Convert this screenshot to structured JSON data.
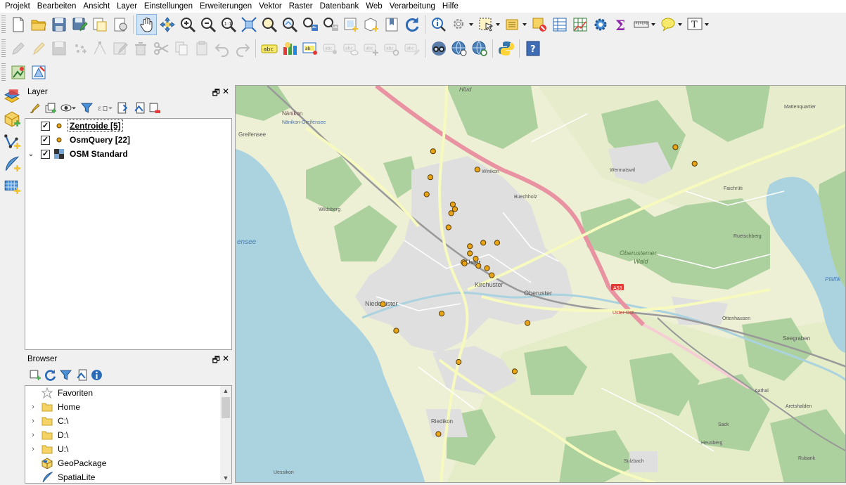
{
  "menubar": {
    "items": [
      "Projekt",
      "Bearbeiten",
      "Ansicht",
      "Layer",
      "Einstellungen",
      "Erweiterungen",
      "Vektor",
      "Raster",
      "Datenbank",
      "Web",
      "Verarbeitung",
      "Hilfe"
    ]
  },
  "layer_panel": {
    "title": "Layer",
    "layers": [
      {
        "name": "Zentroide [5]",
        "checked": true,
        "selected": true,
        "icon": "point-symbol-icon"
      },
      {
        "name": "OsmQuery [22]",
        "checked": true,
        "selected": false,
        "icon": "point-symbol-icon"
      },
      {
        "name": "OSM Standard",
        "checked": true,
        "selected": false,
        "icon": "raster-layer-icon",
        "expanded": true
      }
    ]
  },
  "browser_panel": {
    "title": "Browser",
    "items": [
      {
        "label": "Favoriten",
        "icon": "star-icon",
        "expandable": false
      },
      {
        "label": "Home",
        "icon": "folder-icon",
        "expandable": true
      },
      {
        "label": "C:\\",
        "icon": "folder-icon",
        "expandable": true
      },
      {
        "label": "D:\\",
        "icon": "folder-icon",
        "expandable": true
      },
      {
        "label": "U:\\",
        "icon": "folder-icon",
        "expandable": true
      },
      {
        "label": "GeoPackage",
        "icon": "geopackage-icon",
        "expandable": false
      },
      {
        "label": "SpatiaLite",
        "icon": "spatialite-icon",
        "expandable": false
      }
    ]
  },
  "map": {
    "labels": {
      "nanikon": "Nänikon",
      "nanikon_greifensee": "Nänikon-Greifensee",
      "greifensee_town": "Greifensee",
      "greifensee_lake": "ensee",
      "wildsberg": "Wildsberg",
      "winikon": "Winikon",
      "buechholz": "Buechholz",
      "wermatswil": "Wermatswil",
      "faichruti": "Faichrüti",
      "ruetschberg": "Ruetschberg",
      "oberuster_wald_1": "Oberustemer",
      "oberuster_wald_2": "Wald",
      "oberuster": "Oberuster",
      "kirchuster": "Kirchuster",
      "uster": "Uster",
      "niederuster": "Niederuster",
      "hord": "Hörd",
      "a53": "A53",
      "uster_ost": "Uster-Ost",
      "ottenhausen": "Ottenhausen",
      "seegraben": "Seegraben",
      "pfaffikon": "Pfäffik",
      "aathal": "Aathal",
      "aretshalden": "Aretshalden",
      "sack": "Sack",
      "heusberg": "Heusberg",
      "rubank": "Rubank",
      "sulzbach": "Sulzbach",
      "riedikon": "Riedikon",
      "uessikon": "Uessikon",
      "mattenquartier": "Mattenquartier"
    },
    "colors": {
      "point_fill": "#e8a417",
      "point_stroke": "#5a3d00",
      "motorway": "#e892a2",
      "water": "#aad3df",
      "forest": "#add19e",
      "residential": "#e0dfdf"
    },
    "points": [
      {
        "lon": 8.7128,
        "lat": 47.358
      },
      {
        "lon": 8.7045,
        "lat": 47.3611
      },
      {
        "lon": 8.704,
        "lat": 47.3567
      },
      {
        "lon": 8.7033,
        "lat": 47.3538
      },
      {
        "lon": 8.7082,
        "lat": 47.3521
      },
      {
        "lon": 8.7086,
        "lat": 47.3513
      },
      {
        "lon": 8.7079,
        "lat": 47.3506
      },
      {
        "lon": 8.7074,
        "lat": 47.3482
      },
      {
        "lon": 8.7139,
        "lat": 47.3456
      },
      {
        "lon": 8.7114,
        "lat": 47.345
      },
      {
        "lon": 8.7114,
        "lat": 47.3438
      },
      {
        "lon": 8.7165,
        "lat": 47.3456
      },
      {
        "lon": 8.7125,
        "lat": 47.3429
      },
      {
        "lon": 8.7102,
        "lat": 47.3423
      },
      {
        "lon": 8.7104,
        "lat": 47.3421
      },
      {
        "lon": 8.713,
        "lat": 47.3417
      },
      {
        "lon": 8.7146,
        "lat": 47.3413
      },
      {
        "lon": 8.7155,
        "lat": 47.3401
      },
      {
        "lon": 8.6951,
        "lat": 47.3352
      },
      {
        "lon": 8.7061,
        "lat": 47.3336
      },
      {
        "lon": 8.6976,
        "lat": 47.3307
      },
      {
        "lon": 8.7222,
        "lat": 47.332
      },
      {
        "lon": 8.7093,
        "lat": 47.3254
      },
      {
        "lon": 8.7198,
        "lat": 47.3238
      },
      {
        "lon": 8.7055,
        "lat": 47.3132
      },
      {
        "lon": 8.7499,
        "lat": 47.3618
      },
      {
        "lon": 8.7535,
        "lat": 47.359
      }
    ]
  }
}
